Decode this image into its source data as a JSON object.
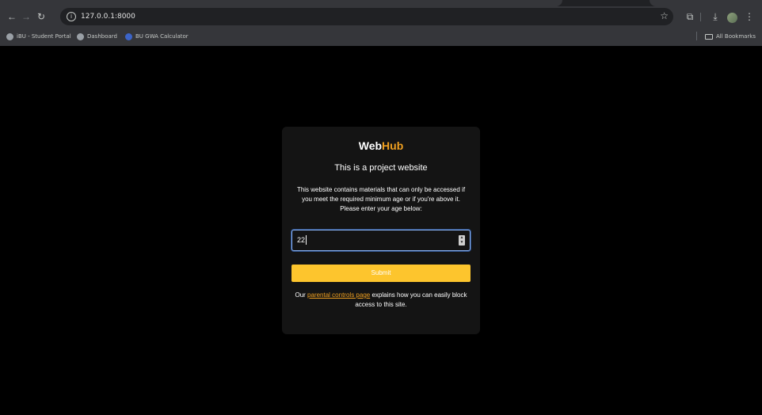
{
  "browser": {
    "url": "127.0.0.1:8000",
    "bookmarks": [
      {
        "label": "iBU - Student Portal"
      },
      {
        "label": "Dashboard"
      },
      {
        "label": "BU GWA Calculator"
      }
    ],
    "all_bookmarks_label": "All Bookmarks"
  },
  "card": {
    "brand_part1": "Web",
    "brand_part2": "Hub",
    "title": "This is a project website",
    "description": "This website contains materials that can only be accessed if you meet the required minimum age or if you're above it. Please enter your age below:",
    "age_value": "22",
    "submit_label": "Submit",
    "footer_prefix": "Our ",
    "footer_link": "parental controls page",
    "footer_suffix": " explains how you can easily block access to this site."
  },
  "colors": {
    "accent": "#fdc52d",
    "brand_orange": "#f0a020",
    "focus_ring": "#8ab4f8"
  }
}
